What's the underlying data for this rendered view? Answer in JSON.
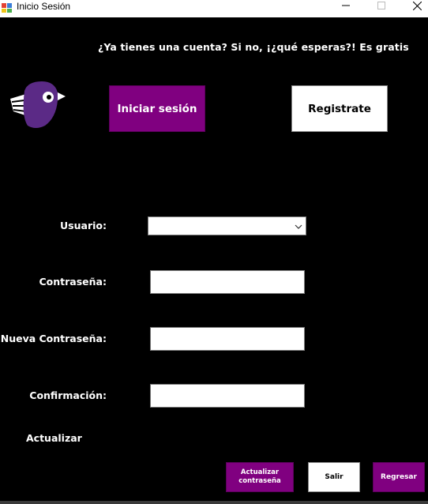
{
  "window": {
    "title": "Inicio Sesión"
  },
  "header": {
    "promo_text": "¿Ya tienes una cuenta? Si no, ¡¿qué esperas?! Es gratis"
  },
  "nav": {
    "login_label": "Iniciar sesión",
    "register_label": "Registrate"
  },
  "form": {
    "user_label": "Usuario:",
    "user_value": "",
    "password_label": "Contraseña:",
    "password_value": "",
    "new_password_label": "Nueva Contraseña:",
    "new_password_value": "",
    "confirm_label": "Confirmación:",
    "confirm_value": ""
  },
  "section": {
    "title": "Actualizar"
  },
  "actions": {
    "update_password_label": "Actualizar contraseña",
    "exit_label": "Salir",
    "back_label": "Regresar"
  },
  "colors": {
    "accent": "#800080",
    "background": "#000000"
  }
}
